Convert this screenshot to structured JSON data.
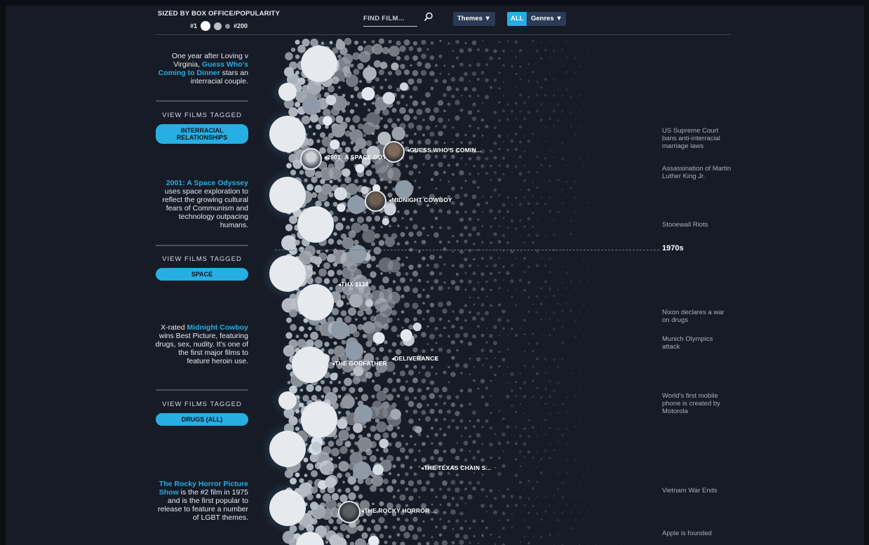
{
  "header": {
    "legend_title": "SIZED BY BOX OFFICE/POPULARITY",
    "legend_rank_top": "#1",
    "legend_rank_bottom": "#200",
    "search_placeholder": "FIND FILM...",
    "themes_label": "Themes ▼",
    "all_label": "ALL",
    "genres_label": "Genres ▼"
  },
  "sidebar": {
    "notes": [
      {
        "pre": "One year after Loving v Virginia, ",
        "highlight": "Guess Who's Coming to Dinner",
        "post": " stars an interracial couple."
      },
      {
        "pre": "",
        "highlight": "2001: A Space Odyssey",
        "post": " uses space exploration to reflect the growing cultural fears of Communism and technology outpacing humans."
      },
      {
        "pre": "X-rated ",
        "highlight": "Midnight Cowboy",
        "post": " wins Best Picture, featuring drugs, sex, nudity. It's one of the first major films to feature heroin use."
      },
      {
        "pre": "",
        "highlight": "The Rocky Horror Picture Show",
        "post": " is the #2 film in 1975 and is the first popular to release to feature a number of LGBT themes."
      }
    ],
    "view_tagged_label": "VIEW FILMS TAGGED",
    "tags": [
      "INTERRACIAL RELATIONSHIPS",
      "SPACE",
      "DRUGS (ALL)"
    ]
  },
  "films": [
    {
      "label": "2001: A SPACE ODY..."
    },
    {
      "label": "GUESS WHO'S COMIN..."
    },
    {
      "label": "MIDNIGHT COWBOY"
    },
    {
      "label": "THX 1138"
    },
    {
      "label": "THE GODFATHER"
    },
    {
      "label": "DELIVERANCE"
    },
    {
      "label": "THE TEXAS CHAIN S..."
    },
    {
      "label": "THE ROCKY HORROR ..."
    }
  ],
  "timeline": {
    "decade": "1970s",
    "events": [
      "US Supreme Court bans anti-interracial marriage laws",
      "Assassination of Martin Luther King Jr.",
      "Stonewall Riots",
      "Nixon declares a war on drugs",
      "Munich Olympics attack",
      "World's first mobile phone is created by Motorola",
      "Vietnam War Ends",
      "Apple is founded"
    ]
  },
  "colors": {
    "accent": "#27aee3",
    "background": "#161b26",
    "bubble_top": "#e6e9ed",
    "bubble_mid": "#8e9aa8",
    "bubble_low": "#3a4250"
  },
  "icons": [
    "search-icon"
  ]
}
